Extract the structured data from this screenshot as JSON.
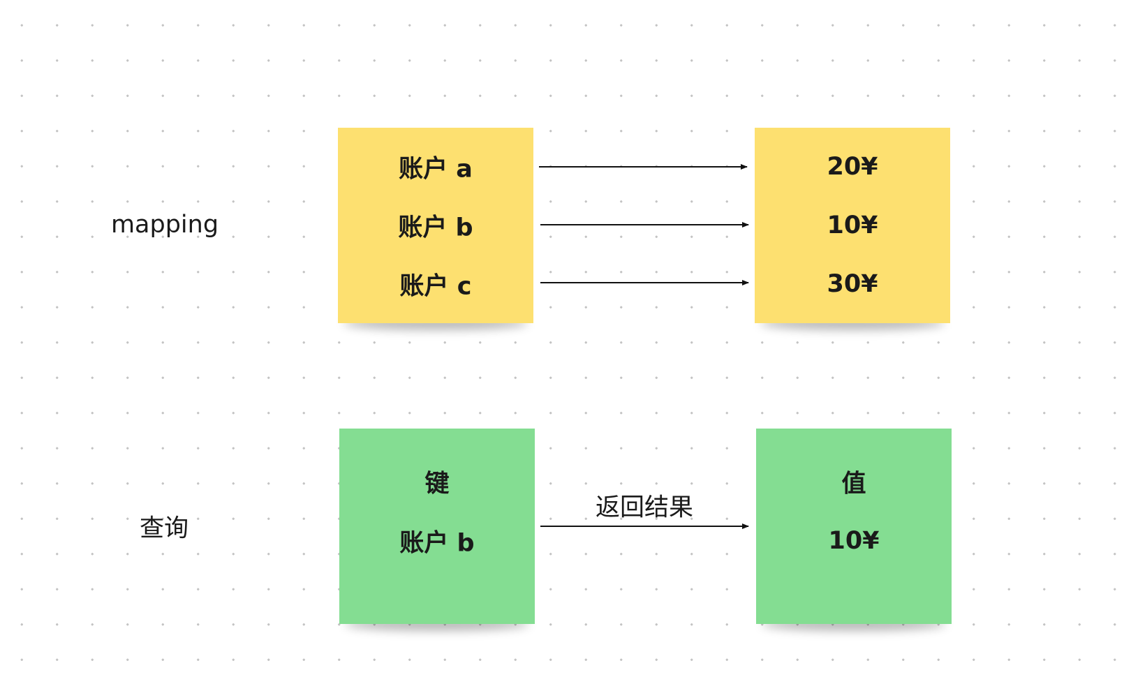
{
  "labels": {
    "mapping": "mapping",
    "query": "查询"
  },
  "mapping": {
    "keys": [
      "账户 a",
      "账户 b",
      "账户 c"
    ],
    "values": [
      "20¥",
      "10¥",
      "30¥"
    ]
  },
  "query": {
    "key_title": "键",
    "key_value": "账户 b",
    "value_title": "值",
    "value_value": "10¥",
    "arrow_label": "返回结果"
  },
  "colors": {
    "yellow_note": "#fde070",
    "green_note": "#84dd92",
    "arrow": "#111111"
  }
}
